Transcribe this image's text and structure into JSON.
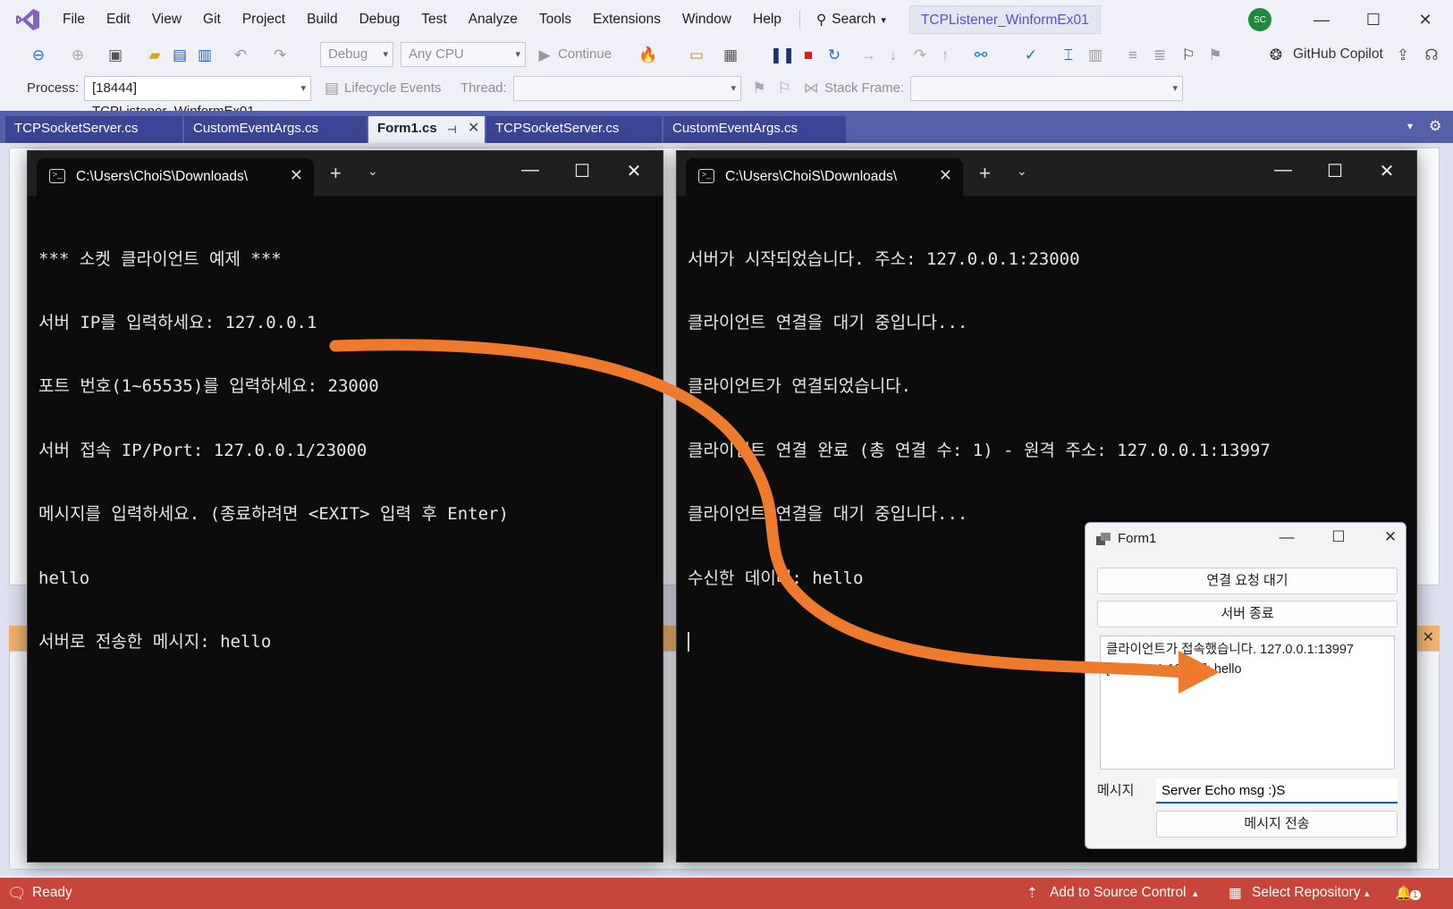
{
  "menubar": {
    "items": [
      "File",
      "Edit",
      "View",
      "Git",
      "Project",
      "Build",
      "Debug",
      "Test",
      "Analyze",
      "Tools",
      "Extensions",
      "Window",
      "Help"
    ],
    "search_label": "Search",
    "solution_title": "TCPListener_WinformEx01",
    "avatar_initials": "SC"
  },
  "toolbar": {
    "config": "Debug",
    "platform": "Any CPU",
    "continue_label": "Continue",
    "copilot_label": "GitHub Copilot"
  },
  "debug_location": {
    "process_label": "Process:",
    "process_value": "[18444] TCPListener_WinformEx01.",
    "lifecycle_label": "Lifecycle Events",
    "thread_label": "Thread:",
    "stack_frame_label": "Stack Frame:"
  },
  "tabs": [
    {
      "label": "TCPSocketServer.cs"
    },
    {
      "label": "CustomEventArgs.cs"
    },
    {
      "label": "Form1.cs"
    },
    {
      "label": "TCPSocketServer.cs"
    },
    {
      "label": "CustomEventArgs.cs"
    }
  ],
  "client_terminal": {
    "tab_title": "C:\\Users\\ChoiS\\Downloads\\",
    "lines": [
      "*** 소켓 클라이언트 예제 ***",
      "서버 IP를 입력하세요: 127.0.0.1",
      "포트 번호(1~65535)를 입력하세요: 23000",
      "서버 접속 IP/Port: 127.0.0.1/23000",
      "메시지를 입력하세요. (종료하려면 <EXIT> 입력 후 Enter)",
      "hello",
      "서버로 전송한 메시지: hello"
    ]
  },
  "server_terminal": {
    "tab_title": "C:\\Users\\ChoiS\\Downloads\\",
    "lines": [
      "서버가 시작되었습니다. 주소: 127.0.0.1:23000",
      "클라이언트 연결을 대기 중입니다...",
      "클라이언트가 연결되었습니다.",
      "클라이언트 연결 완료 (총 연결 수: 1) - 원격 주소: 127.0.0.1:13997",
      "클라이언트 연결을 대기 중입니다...",
      "수신한 데이터: hello"
    ]
  },
  "form1": {
    "title": "Form1",
    "wait_button": "연결 요청 대기",
    "stop_button": "서버 종료",
    "log_lines": [
      "클라이언트가 접속했습니다. 127.0.0.1:13997",
      "[127.0.0.1:13997]: hello"
    ],
    "message_label": "메시지",
    "message_value": "Server Echo msg :)S",
    "send_button": "메시지 전송"
  },
  "statusbar": {
    "ready": "Ready",
    "add_source_control": "Add to Source Control",
    "select_repository": "Select Repository",
    "notification_count": "1"
  },
  "colors": {
    "status_bar": "#c8453c",
    "tab_bar": "#5460a8",
    "arrow": "#ee7a2c"
  }
}
